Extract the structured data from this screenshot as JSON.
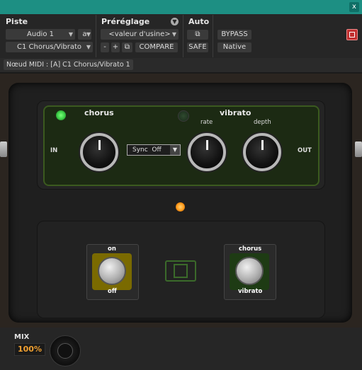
{
  "window": {
    "close_glyph": "x"
  },
  "header": {
    "piste_label": "Piste",
    "preset_label": "Préréglage",
    "auto_label": "Auto",
    "track_name": "Audio 1",
    "track_channel": "a",
    "insert_name": "C1 Chorus/Vibrato",
    "preset_value": "<valeur d'usine>",
    "minus": "-",
    "plus": "+",
    "compare": "COMPARE",
    "bypass": "BYPASS",
    "safe": "SAFE",
    "native": "Native"
  },
  "midi_node": "Nœud MIDI : [A] C1 Chorus/Vibrato 1",
  "plugin": {
    "chorus_label": "chorus",
    "vibrato_label": "vibrato",
    "rate_label": "rate",
    "depth_label": "depth",
    "in_label": "IN",
    "out_label": "OUT",
    "sync_value": "Sync  Off",
    "left_switch_top": "on",
    "left_switch_bottom": "off",
    "right_switch_top": "chorus",
    "right_switch_bottom": "vibrato"
  },
  "mix": {
    "label": "MIX",
    "value": "100%"
  },
  "colors": {
    "titlebar": "#1d8f83",
    "led_green": "#3fd04a",
    "led_orange": "#ff9a1a",
    "mix_value": "#f0a030",
    "panel_green": "#3b5a1f"
  }
}
